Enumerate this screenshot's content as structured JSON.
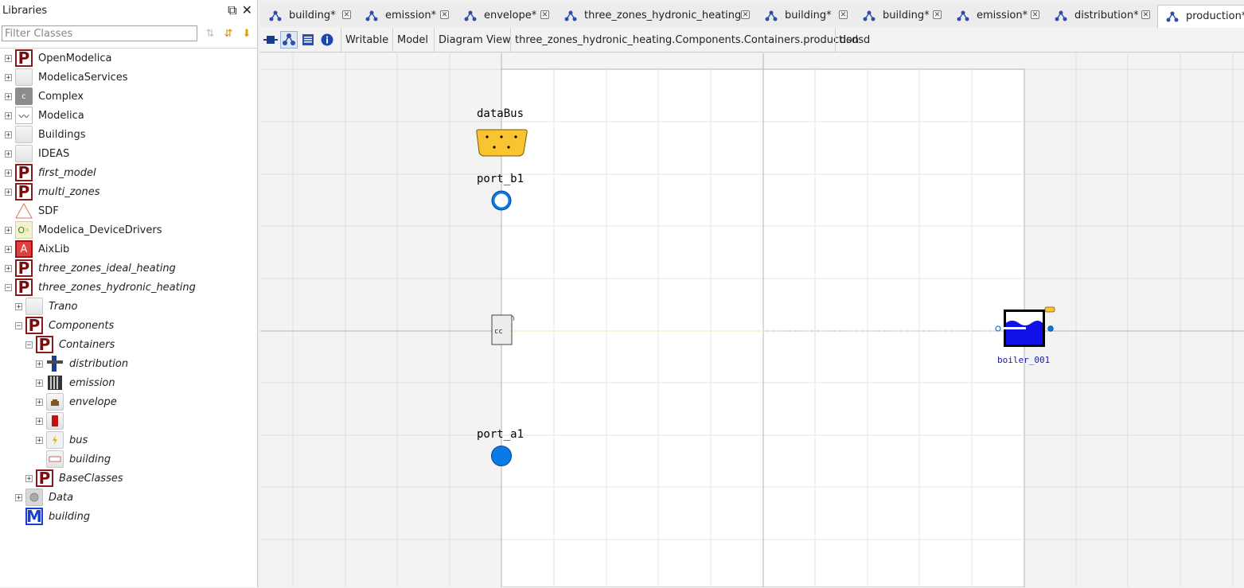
{
  "library": {
    "title": "Libraries",
    "filter_placeholder": "Filter Classes",
    "tree": [
      {
        "label": "OpenModelica",
        "icon": "package-icon",
        "italic": false,
        "expander": "+"
      },
      {
        "label": "ModelicaServices",
        "icon": "blank-icon",
        "italic": false,
        "expander": "+"
      },
      {
        "label": "Complex",
        "icon": "complex-icon",
        "italic": false,
        "expander": "+"
      },
      {
        "label": "Modelica",
        "icon": "modelica-icon",
        "italic": false,
        "expander": "+"
      },
      {
        "label": "Buildings",
        "icon": "blank-icon",
        "italic": false,
        "expander": "+"
      },
      {
        "label": "IDEAS",
        "icon": "blank-icon",
        "italic": false,
        "expander": "+"
      },
      {
        "label": "first_model",
        "icon": "package-icon",
        "italic": true,
        "expander": "+"
      },
      {
        "label": "multi_zones",
        "icon": "package-icon",
        "italic": true,
        "expander": "+"
      },
      {
        "label": "SDF",
        "icon": "sdf-icon",
        "italic": false,
        "expander": ""
      },
      {
        "label": "Modelica_DeviceDrivers",
        "icon": "devicedrivers-icon",
        "italic": false,
        "expander": "+"
      },
      {
        "label": "AixLib",
        "icon": "aixlib-icon",
        "italic": false,
        "expander": "+"
      },
      {
        "label": "three_zones_ideal_heating",
        "icon": "package-icon",
        "italic": true,
        "expander": "+"
      },
      {
        "label": "three_zones_hydronic_heating",
        "icon": "package-icon",
        "italic": true,
        "expander": "−"
      },
      {
        "label": "Trano",
        "icon": "blank-icon",
        "italic": true,
        "expander": "+"
      },
      {
        "label": "Components",
        "icon": "package-icon",
        "italic": true,
        "expander": "−"
      },
      {
        "label": "Containers",
        "icon": "package-icon",
        "italic": true,
        "expander": "−"
      },
      {
        "label": "distribution",
        "icon": "distribution-icon",
        "italic": true,
        "expander": "+"
      },
      {
        "label": "emission",
        "icon": "emission-icon",
        "italic": true,
        "expander": "+"
      },
      {
        "label": "envelope",
        "icon": "envelope-icon",
        "italic": true,
        "expander": "+"
      },
      {
        "label": "",
        "icon": "production-icon",
        "italic": true,
        "expander": "+"
      },
      {
        "label": "bus",
        "icon": "bus-icon",
        "italic": true,
        "expander": "+"
      },
      {
        "label": "building",
        "icon": "building-icon",
        "italic": true,
        "expander": ""
      },
      {
        "label": "BaseClasses",
        "icon": "package-icon",
        "italic": true,
        "expander": "+"
      },
      {
        "label": "Data",
        "icon": "data-icon",
        "italic": true,
        "expander": "+"
      },
      {
        "label": "building",
        "icon": "model-icon",
        "italic": true,
        "expander": ""
      }
    ]
  },
  "tabs": [
    {
      "label": "building*",
      "active": false
    },
    {
      "label": "emission*",
      "active": false
    },
    {
      "label": "envelope*",
      "active": false
    },
    {
      "label": "three_zones_hydronic_heating*",
      "active": false
    },
    {
      "label": "building*",
      "active": false
    },
    {
      "label": "building*",
      "active": false
    },
    {
      "label": "emission*",
      "active": false
    },
    {
      "label": "distribution*",
      "active": false
    },
    {
      "label": "production*",
      "active": true
    }
  ],
  "toolbar": {
    "writable": "Writable",
    "model": "Model",
    "view": "Diagram View",
    "path": "three_zones_hydronic_heating.Components.Containers.production",
    "extra": "dsdsd"
  },
  "diagram": {
    "components": {
      "databus": {
        "label": "dataBus"
      },
      "port_b1": {
        "label": "port_b1"
      },
      "port_a1": {
        "label": "port_a1"
      },
      "cc": {
        "label": "cc"
      },
      "boiler": {
        "label": "boiler_001"
      }
    }
  },
  "colors": {
    "accent_blue": "#0a7be6",
    "bus_yellow": "#f8c430",
    "boiler_blue": "#1010e8",
    "package_red": "#8a1a1a"
  }
}
